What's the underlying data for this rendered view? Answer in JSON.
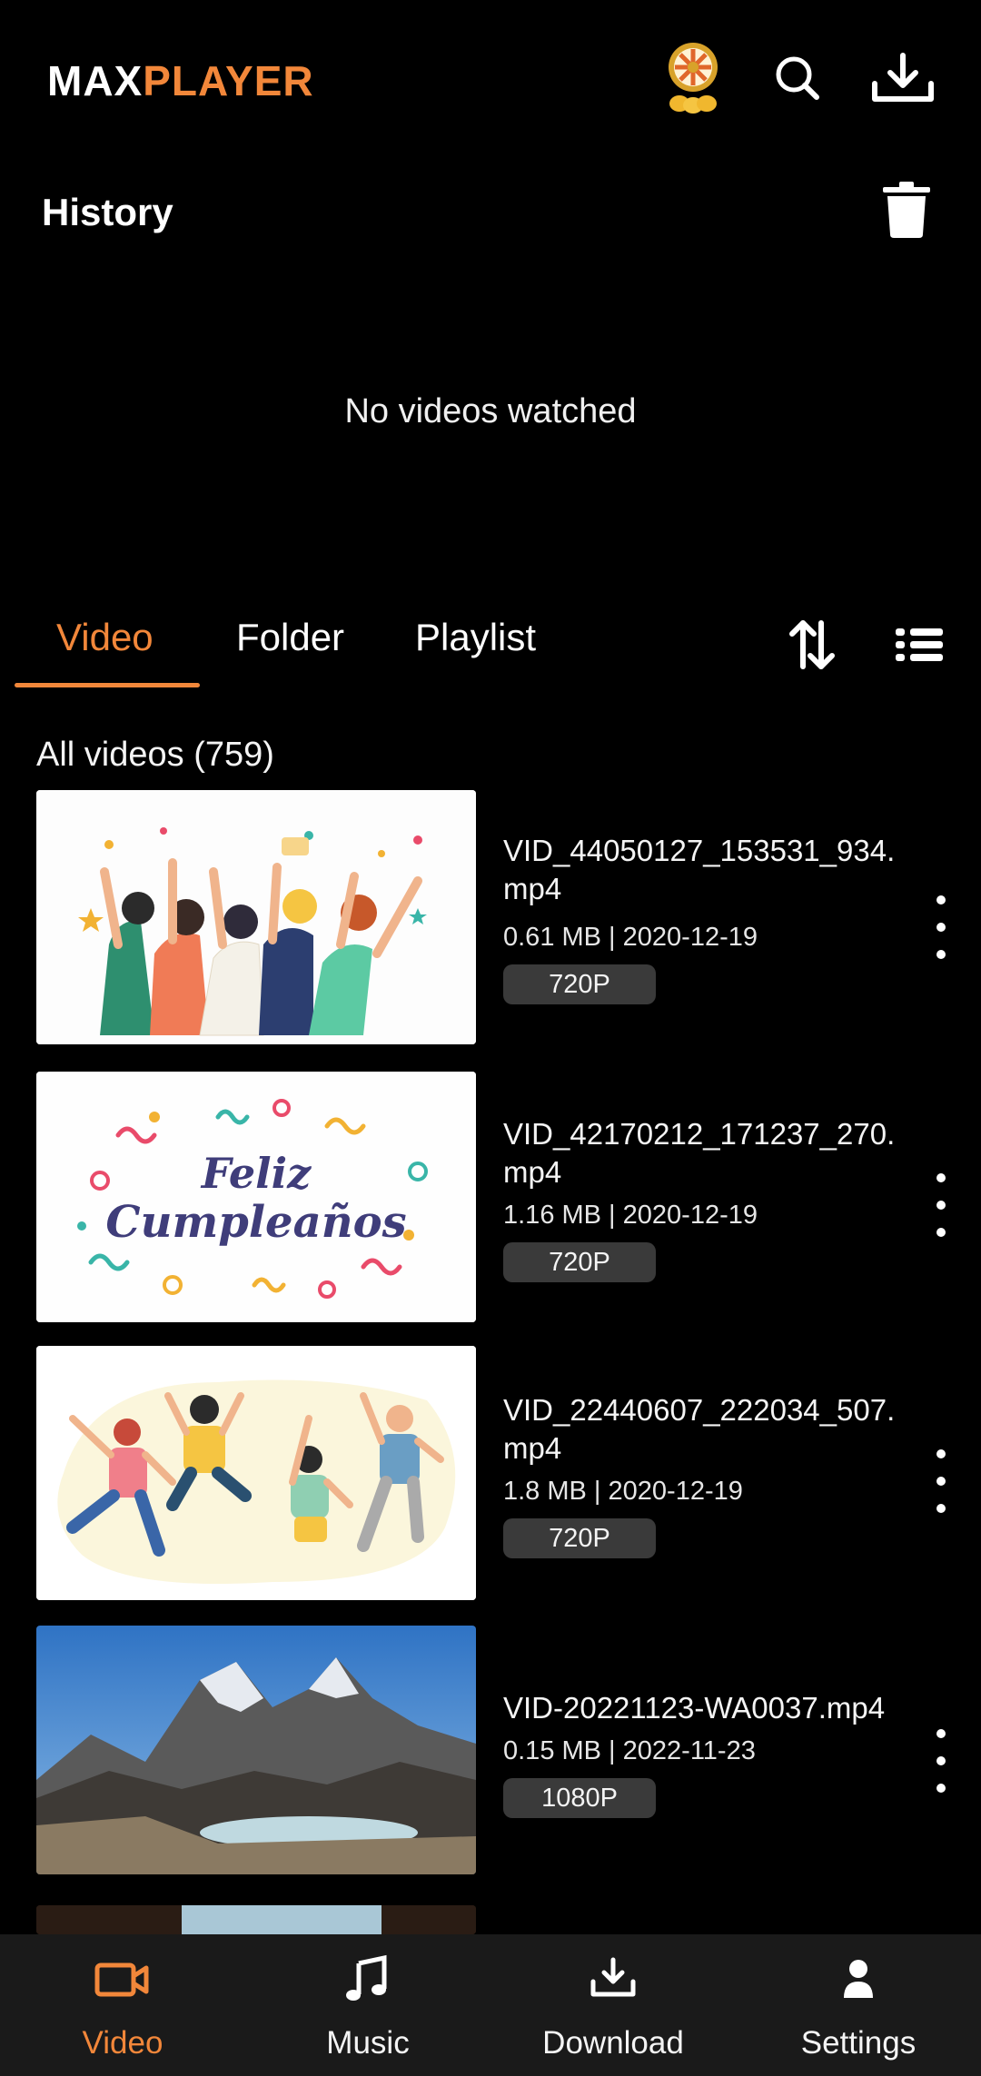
{
  "app": {
    "logo_part1": "MAX",
    "logo_part2": "PLAYER",
    "accent": "#f2873a"
  },
  "header_icons": [
    "lucky-wheel-icon",
    "search-icon",
    "download-icon"
  ],
  "history": {
    "title": "History",
    "empty_message": "No videos watched"
  },
  "tabs": [
    {
      "label": "Video",
      "active": true
    },
    {
      "label": "Folder",
      "active": false
    },
    {
      "label": "Playlist",
      "active": false
    }
  ],
  "list_header": "All videos (759)",
  "videos": [
    {
      "title": "VID_44050127_153531_934.mp4",
      "meta": "0.61 MB | 2020-12-19",
      "resolution": "720P",
      "thumbnail": "party-people"
    },
    {
      "title": "VID_42170212_171237_270.mp4",
      "meta": "1.16 MB | 2020-12-19",
      "resolution": "720P",
      "thumbnail": "feliz-cumpleanos"
    },
    {
      "title": "VID_22440607_222034_507.mp4",
      "meta": "1.8 MB | 2020-12-19",
      "resolution": "720P",
      "thumbnail": "jumping-people"
    },
    {
      "title": "VID-20221123-WA0037.mp4",
      "meta": "0.15 MB | 2022-11-23",
      "resolution": "1080P",
      "thumbnail": "mountains"
    }
  ],
  "thumb_text": {
    "line1": "Feliz",
    "line2": "Cumpleaños"
  },
  "bottom_nav": [
    {
      "label": "Video",
      "icon": "video-camera-icon",
      "active": true
    },
    {
      "label": "Music",
      "icon": "music-note-icon",
      "active": false
    },
    {
      "label": "Download",
      "icon": "download-icon",
      "active": false
    },
    {
      "label": "Settings",
      "icon": "person-icon",
      "active": false
    }
  ]
}
